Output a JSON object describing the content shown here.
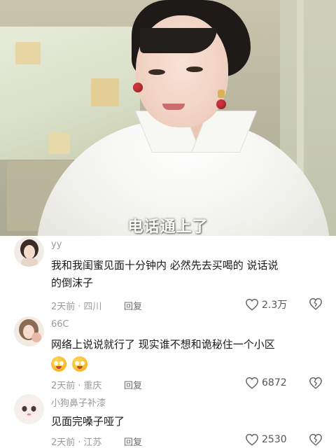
{
  "video": {
    "subtitle": "电话通上了"
  },
  "comments": [
    {
      "username": "yy",
      "text_line1": "我和我闺蜜见面十分钟内 必然先去买喝的  说话说",
      "text_line2": "的倒沫子",
      "time": "2天前",
      "location": "四川",
      "reply_label": "回复",
      "likes": "2.3万"
    },
    {
      "username": "66C",
      "text_line1": "网络上说说就行了 现实谁不想和诡秘住一个小区",
      "emoji_name": "drooling-face-emoji",
      "time": "2天前",
      "location": "重庆",
      "reply_label": "回复",
      "likes": "6872"
    },
    {
      "username": "小狗鼻子补漆",
      "text_line1": "见面完嗓子哑了",
      "time": "2天前",
      "location": "江苏",
      "reply_label": "回复",
      "likes": "2530"
    }
  ],
  "colors": {
    "username": "#9b9b9b",
    "text": "#1a1a1a",
    "meta": "#9a9a9a"
  }
}
